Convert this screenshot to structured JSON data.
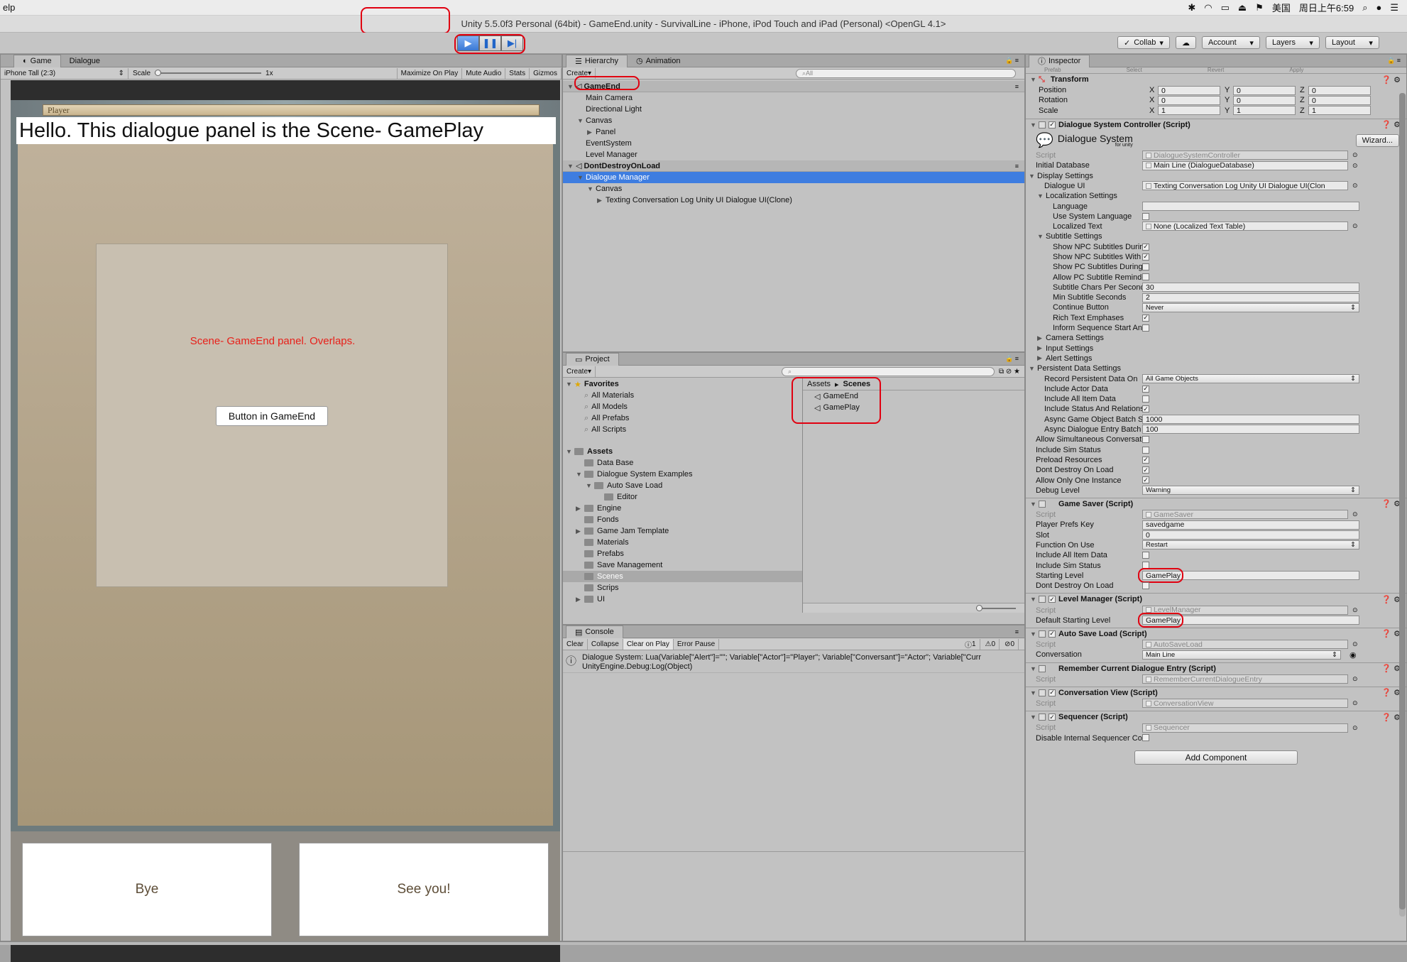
{
  "menubar": {
    "app_menu": "elp",
    "lang": "美国",
    "datetime": "周日上午6:59"
  },
  "window_title": "Unity 5.5.0f3 Personal (64bit) - GameEnd.unity - SurvivalLine - iPhone, iPod Touch and iPad (Personal) <OpenGL 4.1>",
  "toolbar": {
    "collab": "Collab",
    "account": "Account",
    "layers": "Layers",
    "layout": "Layout",
    "play": "▶",
    "pause": "❚❚",
    "step": "▶|"
  },
  "game_panel": {
    "tabs": [
      "Game",
      "Dialogue"
    ],
    "device": "iPhone Tall (2:3)",
    "scale_label": "Scale",
    "scale_value": "1x",
    "toggles": [
      "Maximize On Play",
      "Mute Audio",
      "Stats",
      "Gizmos"
    ],
    "player_label": "Player",
    "dialogue_text": "Hello. This dialogue panel is the Scene- GamePlay",
    "overlap_text": "Scene-  GameEnd panel.  Overlaps.",
    "gameend_button": "Button in GameEnd",
    "responses": [
      "Bye",
      "See you!"
    ]
  },
  "hierarchy": {
    "tabs": [
      "Hierarchy",
      "Animation"
    ],
    "create": "Create",
    "search_placeholder": "All",
    "rows": [
      {
        "label": "GameEnd",
        "scene": true
      },
      {
        "label": "Main Camera"
      },
      {
        "label": "Directional Light"
      },
      {
        "label": "Canvas"
      },
      {
        "label": "Panel"
      },
      {
        "label": "EventSystem"
      },
      {
        "label": "Level Manager"
      },
      {
        "label": "DontDestroyOnLoad",
        "scene": true
      },
      {
        "label": "Dialogue Manager",
        "selected": true
      },
      {
        "label": "Canvas"
      },
      {
        "label": "Texting Conversation Log Unity UI Dialogue UI(Clone)"
      }
    ]
  },
  "project": {
    "tab": "Project",
    "create": "Create",
    "favorites_label": "Favorites",
    "favorites": [
      "All Materials",
      "All Models",
      "All Prefabs",
      "All Scripts"
    ],
    "assets_label": "Assets",
    "assets": [
      "Data Base",
      "Dialogue System Examples",
      "Auto Save Load",
      "Editor",
      "Engine",
      "Fonds",
      "Game Jam Template",
      "Materials",
      "Prefabs",
      "Save Management",
      "Scenes",
      "Scrips",
      "UI"
    ],
    "breadcrumb": [
      "Assets",
      "Scenes"
    ],
    "scenes": [
      "GameEnd",
      "GamePlay"
    ]
  },
  "console": {
    "tab": "Console",
    "buttons": [
      "Clear",
      "Collapse",
      "Clear on Play",
      "Error Pause"
    ],
    "counts": [
      "1",
      "0",
      "0"
    ],
    "line1": "Dialogue System: Lua(Variable[\"Alert\"]=\"\"; Variable[\"Actor\"]=\"Player\"; Variable[\"Conversant\"]=\"Actor\"; Variable[\"Curr",
    "line2": "UnityEngine.Debug:Log(Object)"
  },
  "inspector": {
    "tab": "Inspector",
    "prefab_row": [
      "Prefab",
      "Select",
      "Revert",
      "Apply"
    ],
    "transform": {
      "title": "Transform",
      "rows": [
        {
          "label": "Position",
          "x": "0",
          "y": "0",
          "z": "0"
        },
        {
          "label": "Rotation",
          "x": "0",
          "y": "0",
          "z": "0"
        },
        {
          "label": "Scale",
          "x": "1",
          "y": "1",
          "z": "1"
        }
      ]
    },
    "dsc_title": "Dialogue System Controller (Script)",
    "dsc_logo": "Dialogue System",
    "dsc_logo_sub": "for unity",
    "wizard": "Wizard...",
    "props": [
      {
        "label": "Script",
        "value": "DialogueSystemController",
        "kind": "gray",
        "indent": 0
      },
      {
        "label": "Initial Database",
        "value": "Main Line (DialogueDatabase)",
        "kind": "obj",
        "indent": 0
      },
      {
        "label": "Display Settings",
        "kind": "fold",
        "indent": 0
      },
      {
        "label": "Dialogue UI",
        "value": "Texting Conversation Log Unity UI Dialogue UI(Clon",
        "kind": "obj",
        "indent": 1
      },
      {
        "label": "Localization Settings",
        "kind": "fold",
        "indent": 1
      },
      {
        "label": "Language",
        "value": "",
        "kind": "text",
        "indent": 2
      },
      {
        "label": "Use System Language",
        "kind": "cb",
        "checked": false,
        "indent": 2
      },
      {
        "label": "Localized Text",
        "value": "None (Localized Text Table)",
        "kind": "obj",
        "indent": 2
      },
      {
        "label": "Subtitle Settings",
        "kind": "fold",
        "indent": 1
      },
      {
        "label": "Show NPC Subtitles During Lin",
        "kind": "cb",
        "checked": true,
        "indent": 2
      },
      {
        "label": "Show NPC Subtitles With Respc",
        "kind": "cb",
        "checked": true,
        "indent": 2
      },
      {
        "label": "Show PC Subtitles During Line",
        "kind": "cb",
        "checked": false,
        "indent": 2
      },
      {
        "label": "Allow PC Subtitle Reminders",
        "kind": "cb",
        "checked": false,
        "indent": 2
      },
      {
        "label": "Subtitle Chars Per Second",
        "value": "30",
        "kind": "text",
        "indent": 2
      },
      {
        "label": "Min Subtitle Seconds",
        "value": "2",
        "kind": "text",
        "indent": 2
      },
      {
        "label": "Continue Button",
        "value": "Never",
        "kind": "select",
        "indent": 2
      },
      {
        "label": "Rich Text Emphases",
        "kind": "cb",
        "checked": true,
        "indent": 2
      },
      {
        "label": "Inform Sequence Start And Enc",
        "kind": "cb",
        "checked": false,
        "indent": 2
      },
      {
        "label": "Camera Settings",
        "kind": "foldc",
        "indent": 1
      },
      {
        "label": "Input Settings",
        "kind": "foldc",
        "indent": 1
      },
      {
        "label": "Alert Settings",
        "kind": "foldc",
        "indent": 1
      },
      {
        "label": "Persistent Data Settings",
        "kind": "fold",
        "indent": 0
      },
      {
        "label": "Record Persistent Data On",
        "value": "All Game Objects",
        "kind": "select",
        "indent": 1
      },
      {
        "label": "Include Actor Data",
        "kind": "cb",
        "checked": true,
        "indent": 1
      },
      {
        "label": "Include All Item Data",
        "kind": "cb",
        "checked": false,
        "indent": 1
      },
      {
        "label": "Include Status And Relationship D",
        "kind": "cb",
        "checked": true,
        "indent": 1
      },
      {
        "label": "Async Game Object Batch Size",
        "value": "1000",
        "kind": "text",
        "indent": 1
      },
      {
        "label": "Async Dialogue Entry Batch Size",
        "value": "100",
        "kind": "text",
        "indent": 1
      },
      {
        "label": "Allow Simultaneous Conversations",
        "kind": "cb",
        "checked": false,
        "indent": 0
      },
      {
        "label": "Include Sim Status",
        "kind": "cb",
        "checked": false,
        "indent": 0
      },
      {
        "label": "Preload Resources",
        "kind": "cb",
        "checked": true,
        "indent": 0
      },
      {
        "label": "Dont Destroy On Load",
        "kind": "cb",
        "checked": true,
        "indent": 0
      },
      {
        "label": "Allow Only One Instance",
        "kind": "cb",
        "checked": true,
        "indent": 0
      },
      {
        "label": "Debug Level",
        "value": "Warning",
        "kind": "select",
        "indent": 0
      },
      {
        "label": "Game Saver (Script)",
        "kind": "comp",
        "checked": null
      },
      {
        "label": "Script",
        "value": "GameSaver",
        "kind": "gray",
        "indent": 0
      },
      {
        "label": "Player Prefs Key",
        "value": "savedgame",
        "kind": "text",
        "indent": 0
      },
      {
        "label": "Slot",
        "value": "0",
        "kind": "text",
        "indent": 0
      },
      {
        "label": "Function On Use",
        "value": "Restart",
        "kind": "select",
        "indent": 0
      },
      {
        "label": "Include All Item Data",
        "kind": "cb",
        "checked": false,
        "indent": 0
      },
      {
        "label": "Include Sim Status",
        "kind": "cb",
        "checked": false,
        "indent": 0
      },
      {
        "label": "Starting Level",
        "value": "GamePlay",
        "kind": "text",
        "indent": 0,
        "ring": true
      },
      {
        "label": "Dont Destroy On Load",
        "kind": "cb",
        "checked": false,
        "indent": 0
      },
      {
        "label": "Level Manager (Script)",
        "kind": "comp",
        "checked": true
      },
      {
        "label": "Script",
        "value": "LevelManager",
        "kind": "gray",
        "indent": 0
      },
      {
        "label": "Default Starting Level",
        "value": "GamePlay",
        "kind": "text",
        "indent": 0,
        "ring": true
      },
      {
        "label": "Auto Save Load (Script)",
        "kind": "comp",
        "checked": true
      },
      {
        "label": "Script",
        "value": "AutoSaveLoad",
        "kind": "gray",
        "indent": 0
      },
      {
        "label": "Conversation",
        "value": "Main Line",
        "kind": "select",
        "indent": 0
      },
      {
        "label": "Remember Current Dialogue Entry (Script)",
        "kind": "comp",
        "checked": null
      },
      {
        "label": "Script",
        "value": "RememberCurrentDialogueEntry",
        "kind": "gray",
        "indent": 0
      },
      {
        "label": "Conversation View (Script)",
        "kind": "comp",
        "checked": true
      },
      {
        "label": "Script",
        "value": "ConversationView",
        "kind": "gray",
        "indent": 0
      },
      {
        "label": "Sequencer (Script)",
        "kind": "comp",
        "checked": true
      },
      {
        "label": "Script",
        "value": "Sequencer",
        "kind": "gray",
        "indent": 0
      },
      {
        "label": "Disable Internal Sequencer Commar",
        "kind": "cb",
        "checked": false,
        "indent": 0
      }
    ],
    "add_component": "Add Component"
  },
  "colors": {
    "selection": "#3e7de0",
    "highlight_ring": "#e00010",
    "overlap_text": "#e8201a",
    "play_blue": "#2265c8"
  }
}
